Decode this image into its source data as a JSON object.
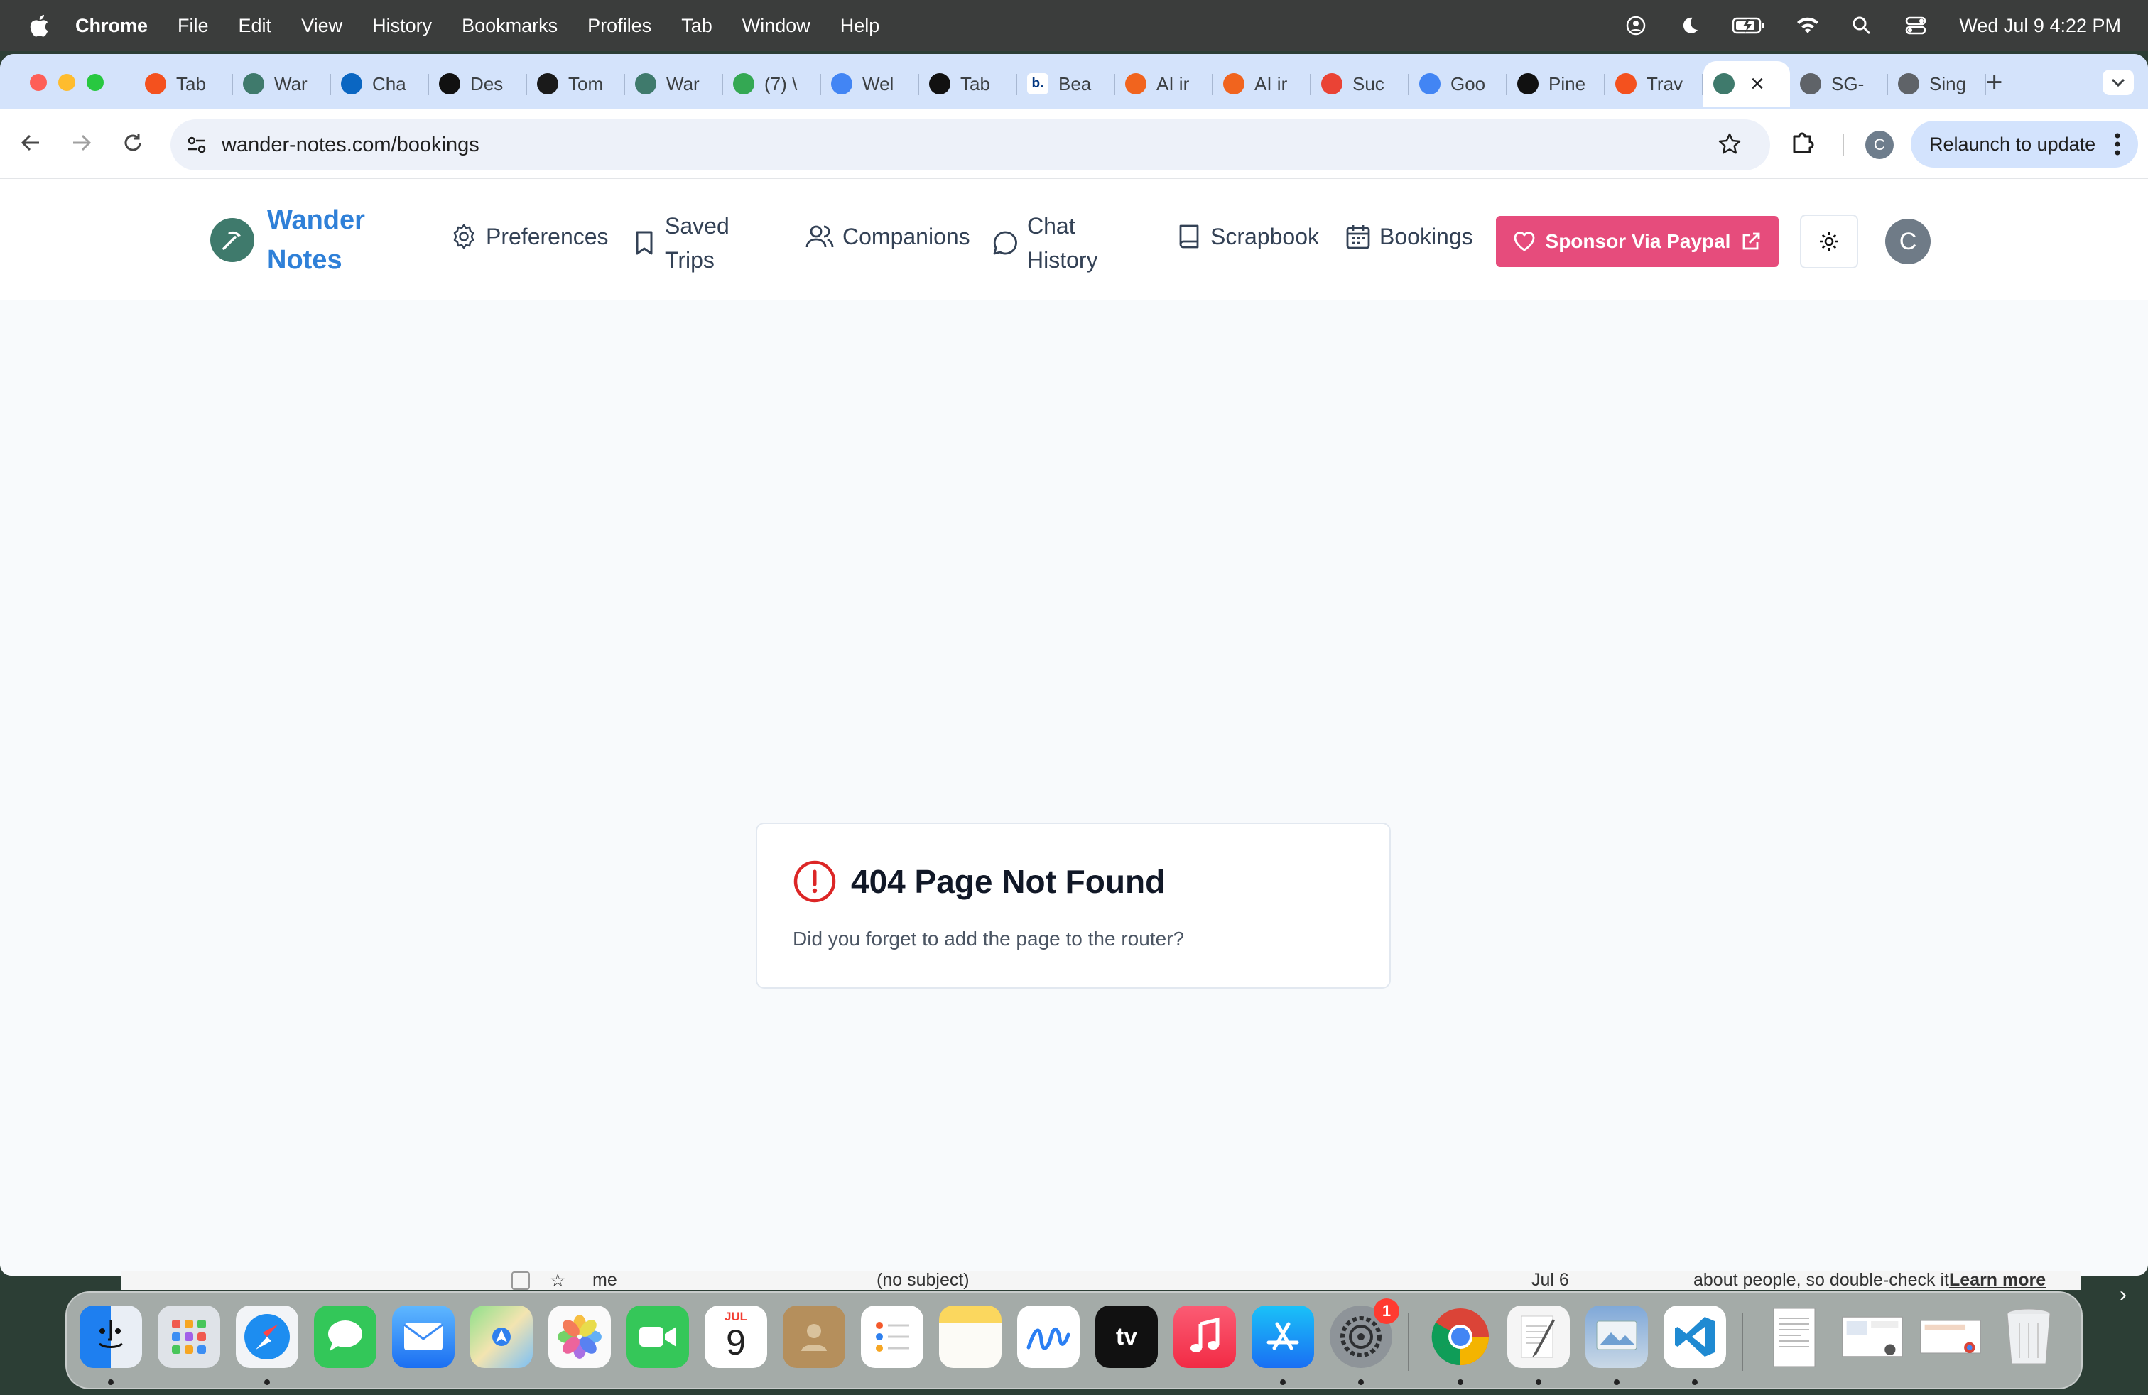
{
  "menubar": {
    "app": "Chrome",
    "items": [
      "File",
      "Edit",
      "View",
      "History",
      "Bookmarks",
      "Profiles",
      "Tab",
      "Window",
      "Help"
    ],
    "clock": "Wed Jul 9  4:22 PM"
  },
  "tabs": [
    {
      "label": "Tab",
      "favicon": "tab-icon",
      "color": "#f4511e"
    },
    {
      "label": "War",
      "favicon": "wander-notes-icon",
      "color": "#3f7a6c"
    },
    {
      "label": "Cha",
      "favicon": "linkedin-icon",
      "color": "#0a66c2"
    },
    {
      "label": "Des",
      "favicon": "amazon-icon",
      "color": "#111111"
    },
    {
      "label": "Tom",
      "favicon": "edb-icon",
      "color": "#1a1a1a"
    },
    {
      "label": "War",
      "favicon": "wander-notes-icon",
      "color": "#3f7a6c"
    },
    {
      "label": "(7) \\",
      "favicon": "question-icon",
      "color": "#34a853"
    },
    {
      "label": "Wel",
      "favicon": "docs-icon",
      "color": "#4285f4"
    },
    {
      "label": "Tab",
      "favicon": "openai-icon",
      "color": "#111111"
    },
    {
      "label": "Bea",
      "favicon": "booking-icon",
      "color": "#ffffff"
    },
    {
      "label": "AI ir",
      "favicon": "etsy-icon",
      "color": "#f1641e"
    },
    {
      "label": "AI ir",
      "favicon": "etsy-icon",
      "color": "#f1641e"
    },
    {
      "label": "Suc",
      "favicon": "gmail-icon",
      "color": "#ea4335"
    },
    {
      "label": "Goo",
      "favicon": "calendar-icon",
      "color": "#4285f4"
    },
    {
      "label": "Pine",
      "favicon": "pinecone-icon",
      "color": "#111111"
    },
    {
      "label": "Trav",
      "favicon": "tab-icon",
      "color": "#f4511e"
    },
    {
      "label": "",
      "favicon": "wander-notes-icon",
      "color": "#3f7a6c",
      "active": true
    },
    {
      "label": "SG-",
      "favicon": "globe-icon",
      "color": "#5f6368"
    },
    {
      "label": "Sing",
      "favicon": "openai-icon",
      "color": "#5f6368"
    }
  ],
  "address_bar": {
    "url": "wander-notes.com/bookings"
  },
  "toolbar": {
    "profile_initial": "C",
    "relaunch_label": "Relaunch to update"
  },
  "app": {
    "brand_line1": "Wander",
    "brand_line2": "Notes",
    "nav": {
      "preferences": "Preferences",
      "saved_trips_1": "Saved",
      "saved_trips_2": "Trips",
      "companions": "Companions",
      "chat_history_1": "Chat",
      "chat_history_2": "History",
      "scrapbook": "Scrapbook",
      "bookings": "Bookings"
    },
    "sponsor_label": "Sponsor Via Paypal",
    "avatar_initial": "C",
    "colors": {
      "brand": "#2f80d8",
      "sponsor": "#e64c7c",
      "error": "#dc2626"
    }
  },
  "error_card": {
    "title": "404 Page Not Found",
    "message": "Did you forget to add the page to the router?"
  },
  "background_mail_row": {
    "sender": "me",
    "subject": "(no subject)",
    "date": "Jul 6",
    "note": "about people, so double-check it.",
    "learn_more": "Learn more"
  },
  "dock": {
    "calendar_month": "JUL",
    "calendar_day": "9",
    "settings_badge": "1",
    "apps": [
      "Finder",
      "Launchpad",
      "Safari",
      "Messages",
      "Mail",
      "Maps",
      "Photos",
      "FaceTime",
      "Calendar",
      "Contacts",
      "Reminders",
      "Notes",
      "Freeform",
      "TV",
      "Music",
      "App Store",
      "System Settings",
      "Chrome",
      "TextEdit",
      "Preview",
      "VS Code",
      "Documents",
      "Screenshots",
      "Downloads",
      "Trash"
    ]
  }
}
